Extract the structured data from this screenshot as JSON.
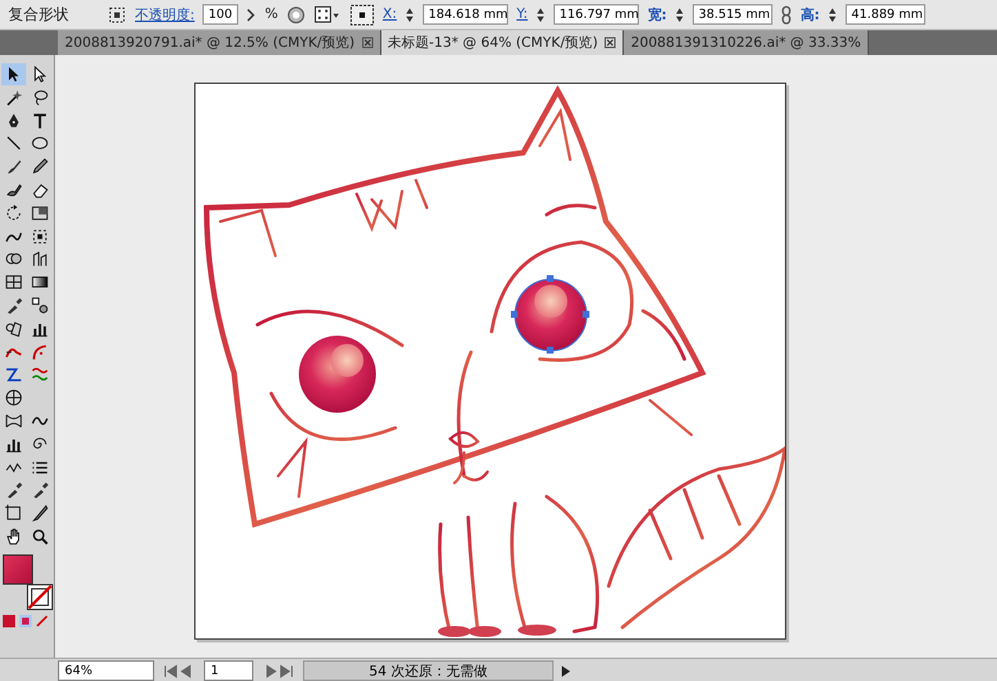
{
  "control_bar": {
    "object_type": "复合形状",
    "opacity_label": "不透明度:",
    "opacity_value": "100",
    "opacity_unit": "%",
    "x_label": "X:",
    "x_value": "184.618 mm",
    "y_label": "Y:",
    "y_value": "116.797 mm",
    "w_label": "宽:",
    "w_value": "38.515 mm",
    "h_label": "高:",
    "h_value": "41.889 mm"
  },
  "tabs": [
    {
      "label": "2008813920791.ai* @ 12.5% (CMYK/预览)",
      "selected": false
    },
    {
      "label": "未标题-13* @ 64% (CMYK/预览)",
      "selected": true
    },
    {
      "label": "200881391310226.ai* @ 33.33%",
      "selected": false
    }
  ],
  "tools": [
    {
      "kind": "selection",
      "selected": true
    },
    {
      "kind": "direct-selection",
      "selected": false
    },
    {
      "kind": "magic-wand",
      "selected": false
    },
    {
      "kind": "lasso",
      "selected": false
    },
    {
      "kind": "pen",
      "selected": false
    },
    {
      "kind": "type",
      "selected": false
    },
    {
      "kind": "line",
      "selected": false
    },
    {
      "kind": "ellipse",
      "selected": false
    },
    {
      "kind": "brush",
      "selected": false
    },
    {
      "kind": "pencil",
      "selected": false
    },
    {
      "kind": "blob-brush",
      "selected": false
    },
    {
      "kind": "eraser",
      "selected": false
    },
    {
      "kind": "rotate",
      "selected": false
    },
    {
      "kind": "scale",
      "selected": false
    },
    {
      "kind": "warp",
      "selected": false
    },
    {
      "kind": "free-transform",
      "selected": false
    },
    {
      "kind": "shape-builder",
      "selected": false
    },
    {
      "kind": "graph",
      "selected": false
    },
    {
      "kind": "mesh",
      "selected": false
    },
    {
      "kind": "gradient",
      "selected": false
    },
    {
      "kind": "eyedropper",
      "selected": false
    },
    {
      "kind": "blend",
      "selected": false
    },
    {
      "kind": "symbol",
      "selected": false
    },
    {
      "kind": "column-graph",
      "selected": false
    },
    {
      "kind": "anchor-curve",
      "selected": false
    },
    {
      "kind": "hook-curve",
      "selected": false
    },
    {
      "kind": "zigzag-path",
      "selected": false
    },
    {
      "kind": "wave-lines",
      "selected": false
    },
    {
      "kind": "crosshair",
      "selected": false
    },
    {
      "kind": "pucker",
      "selected": false
    },
    {
      "kind": "wave",
      "selected": false
    },
    {
      "kind": "column-graph",
      "selected": false
    },
    {
      "kind": "twirl",
      "selected": false
    },
    {
      "kind": "zigzag",
      "selected": false
    },
    {
      "kind": "list-lines",
      "selected": false
    },
    {
      "kind": "eyedropper",
      "selected": false
    },
    {
      "kind": "eyedropper",
      "selected": false
    },
    {
      "kind": "artboard",
      "selected": false
    },
    {
      "kind": "knife",
      "selected": false
    },
    {
      "kind": "hand",
      "selected": false
    },
    {
      "kind": "zoom",
      "selected": false
    }
  ],
  "status_bar": {
    "zoom": "64%",
    "page": "1",
    "message": "54 次还原：无需做"
  }
}
